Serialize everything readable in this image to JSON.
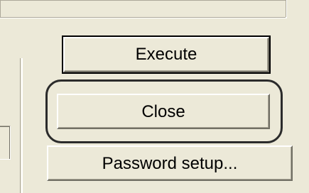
{
  "dialog": {
    "buttons": {
      "execute_label": "Execute",
      "close_label": "Close",
      "password_setup_label": "Password setup..."
    }
  },
  "colors": {
    "background": "#ece9d8",
    "highlight": "#ffffff",
    "shadow": "#716f64",
    "focus_ring": "#2b2b2b"
  }
}
